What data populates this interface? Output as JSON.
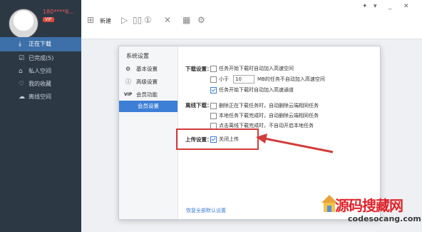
{
  "sidebar": {
    "username": "180****8...",
    "vip": "VIP",
    "items": [
      {
        "icon": "⤓",
        "label": "正在下载",
        "active": true
      },
      {
        "icon": "☑",
        "label": "已完成(5)",
        "active": false
      },
      {
        "icon": "⌂",
        "label": "私人空间",
        "active": false
      },
      {
        "icon": "♡",
        "label": "我的收藏",
        "active": false
      },
      {
        "icon": "☁",
        "label": "离线空间",
        "active": false
      }
    ]
  },
  "toolbar": {
    "new_label": "新建",
    "icons": [
      "new-icon",
      "play-icon",
      "pause-icon",
      "clock-icon",
      "delete-icon",
      "grid-icon",
      "settings-icon"
    ]
  },
  "window": {
    "min": "_",
    "close": "✕",
    "skin": "✦",
    "menu": "▾"
  },
  "dialog": {
    "title": "系统设置",
    "nav": [
      {
        "icon": "⚙",
        "label": "基本设置"
      },
      {
        "icon": "ⓘ",
        "label": "高级设置"
      },
      {
        "icon": "VIP",
        "label": "会员功能"
      },
      {
        "icon": "",
        "label": "会员设置"
      }
    ],
    "download_section": "下载设置：",
    "download_opts": [
      {
        "text": "任务开始下载时自动加入高速空间",
        "checked": false
      },
      {
        "text": "MB的任务不自动加入高速空间",
        "prefix": "小于",
        "value": "10",
        "checked": false
      },
      {
        "text": "任务开始下载时自动加入高速通道",
        "checked": true
      }
    ],
    "offline_section": "离线下载：",
    "offline_opts": [
      {
        "text": "删除正在下载任务时，自动删除云端相同任务",
        "checked": false
      },
      {
        "text": "本地任务下载完成时，自动删除云端相同任务",
        "checked": false
      },
      {
        "text": "点击离线下载完成时，不自动开启本地任务",
        "checked": false
      }
    ],
    "upload_section": "上传设置：",
    "upload_opts": [
      {
        "text": "关闭上传",
        "checked": true
      }
    ],
    "restore": "恢复全部默认设置"
  },
  "watermark": {
    "cn": "源码搜藏网",
    "url": "codesocang.com"
  },
  "colors": {
    "sidebar": "#2c3844",
    "accent": "#3d7ed6",
    "highlight": "#d23c3c"
  }
}
